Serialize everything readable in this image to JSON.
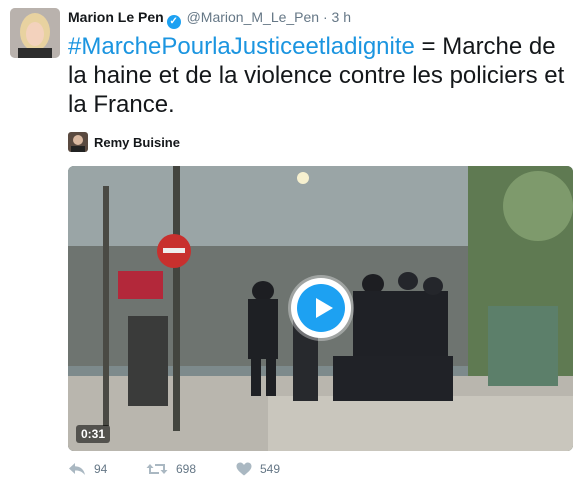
{
  "tweet": {
    "author_name": "Marion Le Pen",
    "handle": "@Marion_M_Le_Pen",
    "separator": "·",
    "time": "3 h",
    "hashtag": "#MarchePourlaJusticeetladignite",
    "text": " = Marche de la haine et de la violence contre les policiers et la France."
  },
  "media": {
    "credit_name": "Remy Buisine",
    "duration": "0:31"
  },
  "actions": {
    "replies": "94",
    "retweets": "698",
    "likes": "549"
  },
  "icons": {
    "verified": "verified-badge-icon",
    "reply": "reply-icon",
    "retweet": "retweet-icon",
    "like": "heart-icon",
    "play": "play-icon"
  },
  "colors": {
    "accent": "#1da1f2",
    "hashtag": "#1b95e0",
    "muted": "#657786"
  }
}
